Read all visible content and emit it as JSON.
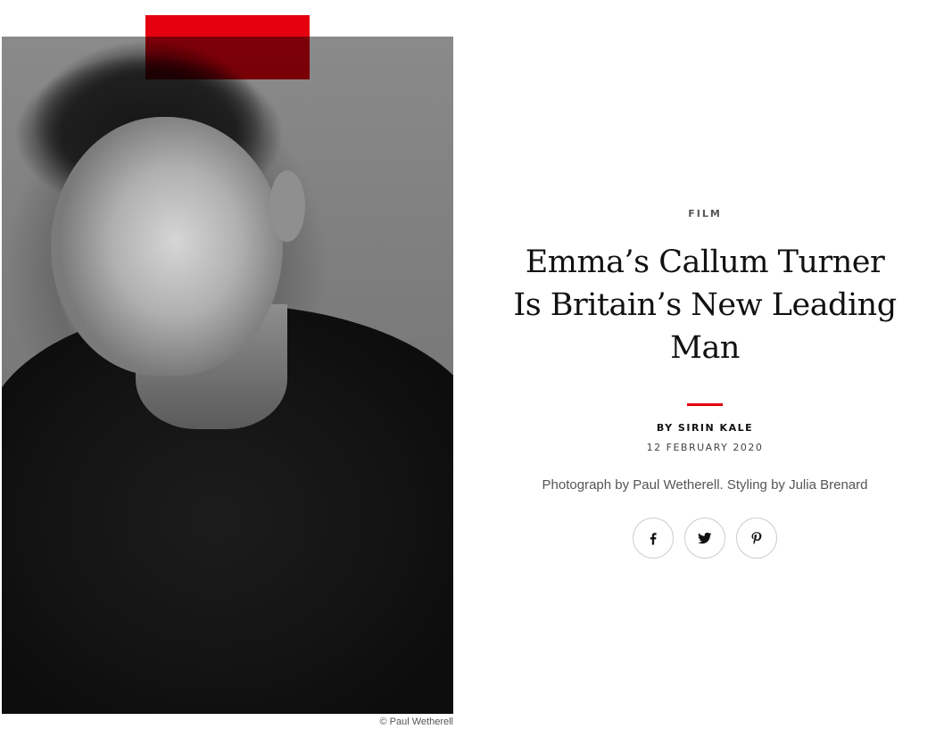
{
  "photo": {
    "alt_icon": "portrait-photo",
    "credit": "© Paul Wetherell",
    "accent_color": "#e4000f"
  },
  "article": {
    "category": "FILM",
    "headline": "Emma’s Callum Turner Is Britain’s New Leading Man",
    "byline": "BY SIRIN KALE",
    "date": "12 FEBRUARY 2020",
    "photo_credit_line": "Photograph by Paul Wetherell. Styling by Julia Brenard"
  },
  "share": {
    "buttons": [
      {
        "icon": "facebook-icon"
      },
      {
        "icon": "twitter-icon"
      },
      {
        "icon": "pinterest-icon"
      }
    ]
  }
}
